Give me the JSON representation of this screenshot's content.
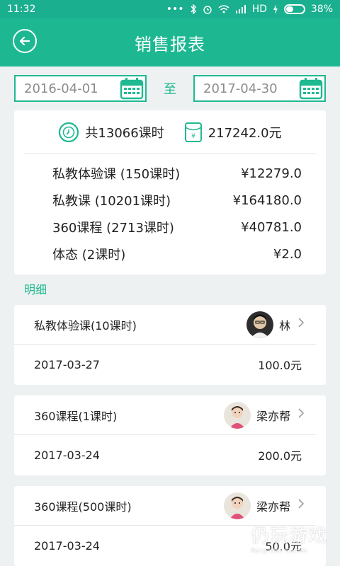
{
  "status_bar": {
    "time": "11:32",
    "network": "HD",
    "battery": "38%",
    "battery_level": 0.38
  },
  "header": {
    "title": "销售报表"
  },
  "date_range": {
    "start": "2016-04-01",
    "separator": "至",
    "end": "2017-04-30"
  },
  "summary": {
    "total_hours": "共13066课时",
    "total_amount": "217242.0元",
    "rows": [
      {
        "name": "私教体验课 (150课时)",
        "amount": "¥12279.0"
      },
      {
        "name": "私教课 (10201课时)",
        "amount": "¥164180.0"
      },
      {
        "name": "360课程 (2713课时)",
        "amount": "¥40781.0"
      },
      {
        "name": "体态 (2课时)",
        "amount": "¥2.0"
      }
    ]
  },
  "details_label": "明细",
  "details": [
    {
      "course": "私教体验课(10课时)",
      "trainer": "林",
      "date": "2017-03-27",
      "amount": "100.0元"
    },
    {
      "course": "360课程(1课时)",
      "trainer": "梁亦帮",
      "date": "2017-03-24",
      "amount": "200.0元"
    },
    {
      "course": "360课程(500课时)",
      "trainer": "梁亦帮",
      "date": "2017-03-24",
      "amount": "50.0元"
    }
  ],
  "watermark": {
    "text": "仍玩游戏",
    "sub": "Reng Wan Games"
  },
  "colors": {
    "accent": "#1db892",
    "background": "#eef1f1"
  }
}
